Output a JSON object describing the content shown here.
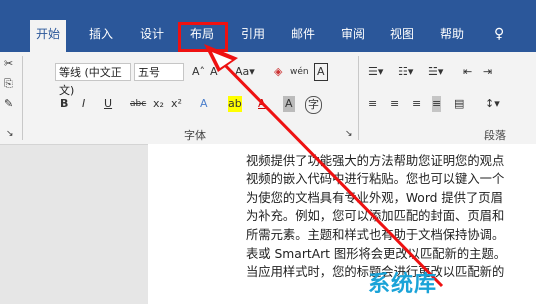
{
  "tabs": [
    "开始",
    "插入",
    "设计",
    "布局",
    "引用",
    "邮件",
    "审阅",
    "视图",
    "帮助"
  ],
  "tab_extra_icon": "lightbulb-icon",
  "font": {
    "name": "等线 (中文正文)",
    "size": "五号"
  },
  "ribbon_groups": {
    "font": "字体",
    "paragraph": "段落"
  },
  "font_buttons": [
    "B",
    "I",
    "U",
    "abc",
    "x₂",
    "x²",
    "A",
    "A",
    "A",
    "A",
    "A"
  ],
  "doc_lines": [
    "视频提供了功能强大的方法帮助您证明您的观点",
    "视频的嵌入代码中进行粘贴。您也可以键入一个",
    "为使您的文档具有专业外观，Word 提供了页眉",
    "为补充。例如，您可以添加匹配的封面、页眉和",
    "所需元素。主题和样式也有助于文档保持协调。",
    "表或 SmartArt 图形将会更改以匹配新的主题。",
    "当应用样式时，您的标题会进行更改以匹配新的"
  ],
  "watermark": "系统库",
  "colors": {
    "ribbon_blue": "#2b579a",
    "highlight": "#ee1111"
  }
}
